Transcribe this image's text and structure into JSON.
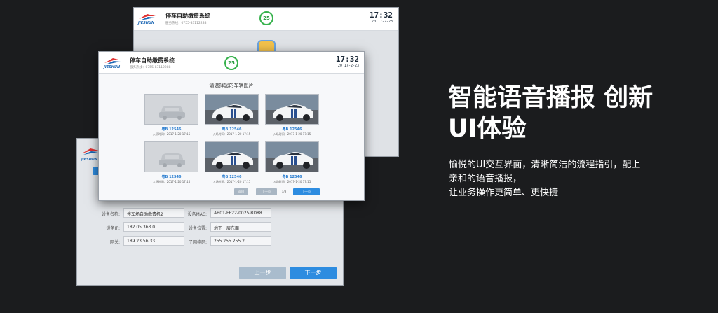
{
  "app": {
    "logo_text": "JIESHUN",
    "system_title": "停车自助缴费系统",
    "service_phone": "服务热线：0755-83112288",
    "countdown": "25",
    "clock_time": "17:32",
    "clock_date": "20 17-2-23"
  },
  "front": {
    "heading": "请选择您的车辆图片",
    "cards": [
      {
        "plate": "粤B 12546",
        "time": "入场时间：2017-1-20  17:15",
        "image": "placeholder-car"
      },
      {
        "plate": "粤B 12546",
        "time": "入场时间：2017-1-20  17:15",
        "image": "white-sports-car"
      },
      {
        "plate": "粤B 12546",
        "time": "入场时间：2017-1-20  17:15",
        "image": "white-sports-car"
      },
      {
        "plate": "粤B 12546",
        "time": "入场时间：2017-1-20  17:15",
        "image": "placeholder-car"
      },
      {
        "plate": "粤B 12546",
        "time": "入场时间：2017-1-20  17:15",
        "image": "white-sports-car"
      },
      {
        "plate": "粤B 12546",
        "time": "入场时间：2017-1-20  17:15",
        "image": "white-sports-car"
      }
    ],
    "pagination": {
      "back_label": "返回",
      "prev_label": "上一页",
      "page_indicator": "1/3",
      "next_label": "下一页"
    }
  },
  "device_form": {
    "fields": [
      {
        "label": "设备名称:",
        "value": "停车场自助缴费机2"
      },
      {
        "label": "设备MAC:",
        "value": "AB01-FE22-0025-BD88"
      },
      {
        "label": "设备IP:",
        "value": "182.05.363.0"
      },
      {
        "label": "设备位置:",
        "value": "地下一层东面"
      },
      {
        "label": "网关:",
        "value": "189.23.56.33"
      },
      {
        "label": "子网掩码:",
        "value": "255.255.255.2"
      }
    ],
    "prev_step_label": "上一步",
    "next_step_label": "下一步"
  },
  "promo": {
    "headline_line1": "智能语音播报 创新",
    "headline_line2": "UI体验",
    "desc_line1": "愉悦的UI交互界面，清晰简洁的流程指引，配上",
    "desc_line2": "亲和的语音播报，",
    "desc_line3": "让业务操作更简单、更快捷"
  },
  "colors": {
    "background": "#1b1c1e",
    "brand_blue": "#2d8ce0",
    "timer_green": "#37b24d",
    "plate_blue": "#2d7fd0"
  }
}
